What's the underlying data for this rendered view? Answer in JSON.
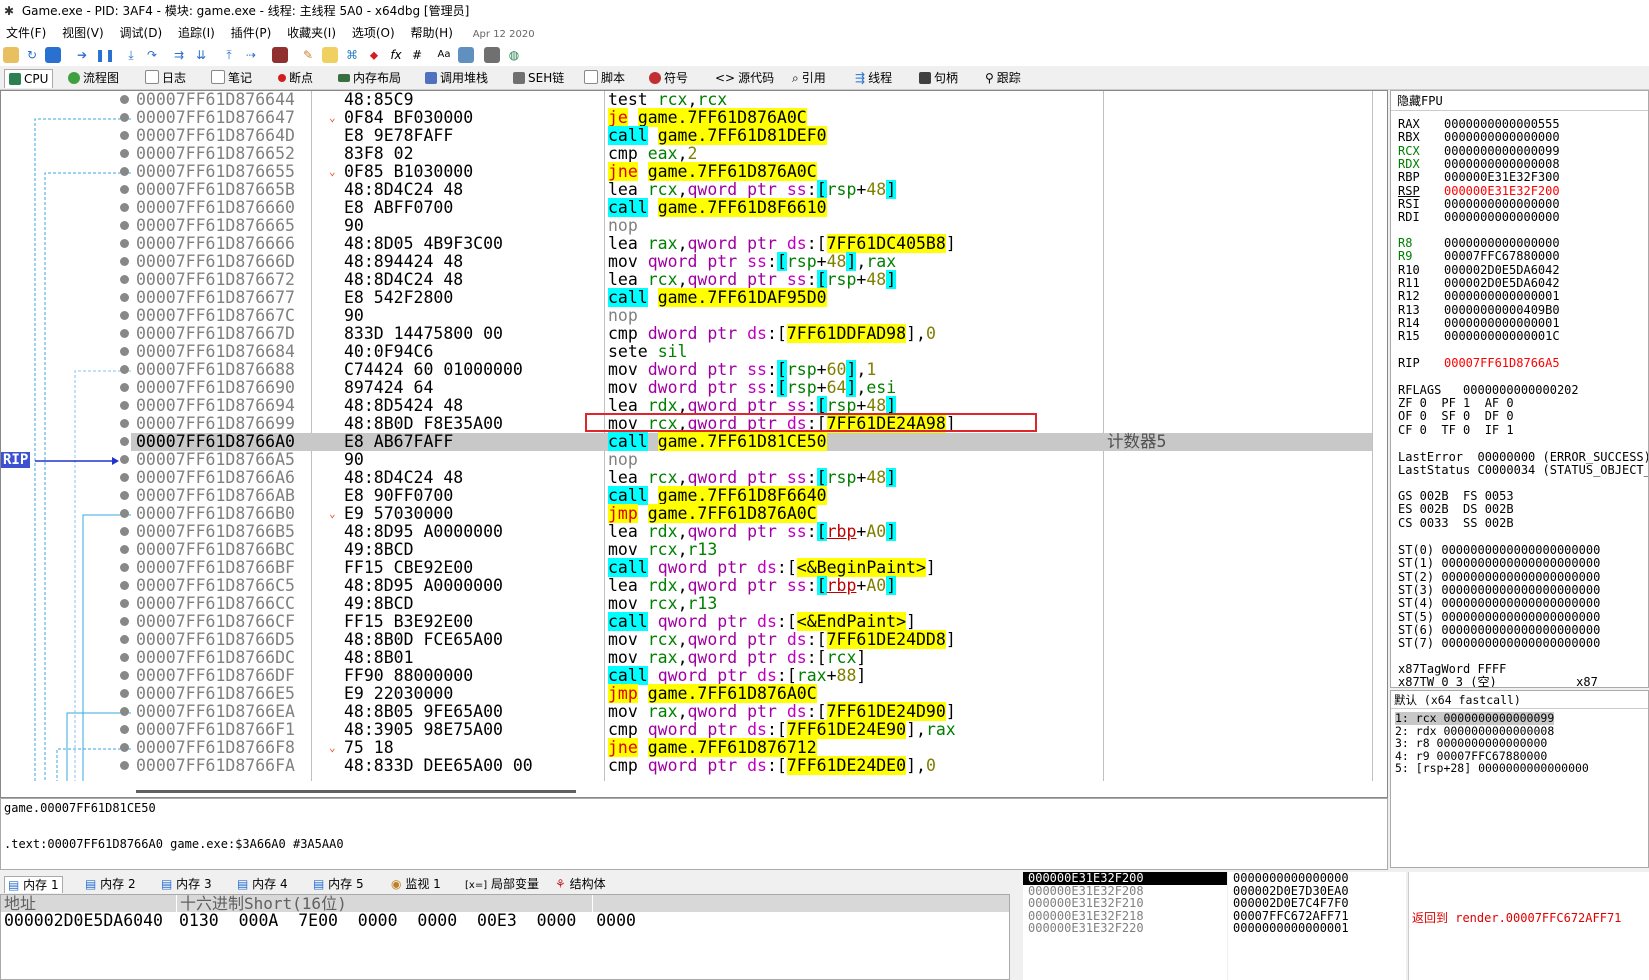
{
  "window": {
    "title": "Game.exe - PID: 3AF4 - 模块: game.exe - 线程: 主线程 5A0 - x64dbg [管理员]"
  },
  "menu": {
    "items": [
      "文件(F)",
      "视图(V)",
      "调试(D)",
      "追踪(I)",
      "插件(P)",
      "收藏夹(I)",
      "选项(O)",
      "帮助(H)"
    ],
    "date": "Apr 12 2020"
  },
  "toolbar": {
    "icons": [
      "open-icon",
      "restart-icon",
      "stop-icon",
      "run-icon",
      "pause-icon",
      "step-into-icon",
      "step-over-icon",
      "trace-into-icon",
      "trace-over-icon",
      "execute-till-return-icon",
      "run-to-user-code-icon",
      "scylla-icon",
      "patch-icon",
      "comment-icon",
      "label-icon",
      "bookmark-icon",
      "function-icon",
      "hash-icon",
      "font-icon",
      "strings-icon",
      "calculator-icon",
      "globe-icon"
    ]
  },
  "tabs": [
    {
      "label": "CPU",
      "icon": "cpu-icon",
      "active": true
    },
    {
      "label": "流程图",
      "icon": "graph-icon"
    },
    {
      "label": "日志",
      "icon": "log-icon"
    },
    {
      "label": "笔记",
      "icon": "notes-icon"
    },
    {
      "label": "断点",
      "icon": "breakpoint-icon"
    },
    {
      "label": "内存布局",
      "icon": "memory-map-icon"
    },
    {
      "label": "调用堆栈",
      "icon": "callstack-icon"
    },
    {
      "label": "SEH链",
      "icon": "seh-icon"
    },
    {
      "label": "脚本",
      "icon": "script-icon"
    },
    {
      "label": "符号",
      "icon": "symbol-icon"
    },
    {
      "label": "源代码",
      "icon": "source-icon"
    },
    {
      "label": "引用",
      "icon": "references-icon"
    },
    {
      "label": "线程",
      "icon": "threads-icon"
    },
    {
      "label": "句柄",
      "icon": "handles-icon"
    },
    {
      "label": "跟踪",
      "icon": "trace-icon"
    }
  ],
  "disasm": {
    "rip_label": "RIP",
    "rows": [
      {
        "addr": "00007FF61D876644",
        "bytes": "48:85C9",
        "mark": "",
        "html": "<span class='mn'>test</span> <span class='rg'>rcx</span>,<span class='rg'>rcx</span>",
        "comment": ""
      },
      {
        "addr": "00007FF61D876647",
        "bytes": "0F84 BF030000",
        "mark": "⌄",
        "html": "<span class='mn-je'>je</span> <span class='hl-y'>game.7FF61D876A0C</span>",
        "comment": ""
      },
      {
        "addr": "00007FF61D87664D",
        "bytes": "E8 9E78FAFF",
        "mark": "",
        "html": "<span class='mn-call'>call</span> <span class='hl-y'>game.7FF61D81DEF0</span>",
        "comment": ""
      },
      {
        "addr": "00007FF61D876652",
        "bytes": "83F8 02",
        "mark": "",
        "html": "<span class='mn'>cmp</span> <span class='rg'>eax</span>,<span class='num'>2</span>",
        "comment": ""
      },
      {
        "addr": "00007FF61D876655",
        "bytes": "0F85 B1030000",
        "mark": "⌄",
        "html": "<span class='mn-je'>jne</span> <span class='hl-y'>game.7FF61D876A0C</span>",
        "comment": ""
      },
      {
        "addr": "00007FF61D87665B",
        "bytes": "48:8D4C24 48",
        "mark": "",
        "html": "<span class='mn'>lea</span> <span class='rg'>rcx</span>,<span class='kw'>qword ptr</span> <span class='sg'>ss</span>:<span class='hl-c'>[</span><span class='rg'>rsp</span>+<span class='num'>48</span><span class='hl-c'>]</span>",
        "comment": ""
      },
      {
        "addr": "00007FF61D876660",
        "bytes": "E8 ABFF0700",
        "mark": "",
        "html": "<span class='mn-call'>call</span> <span class='hl-y'>game.7FF61D8F6610</span>",
        "comment": ""
      },
      {
        "addr": "00007FF61D876665",
        "bytes": "90",
        "mark": "",
        "html": "<span class='mn-nop'>nop</span>",
        "comment": ""
      },
      {
        "addr": "00007FF61D876666",
        "bytes": "48:8D05 4B9F3C00",
        "mark": "",
        "html": "<span class='mn'>lea</span> <span class='rg'>rax</span>,<span class='kw'>qword ptr</span> <span class='sg'>ds</span>:[<span class='hl-y'>7FF61DC405B8</span>]",
        "comment": ""
      },
      {
        "addr": "00007FF61D87666D",
        "bytes": "48:894424 48",
        "mark": "",
        "html": "<span class='mn'>mov</span> <span class='kw'>qword ptr</span> <span class='sg'>ss</span>:<span class='hl-c'>[</span><span class='rg'>rsp</span>+<span class='num'>48</span><span class='hl-c'>]</span>,<span class='rg'>rax</span>",
        "comment": ""
      },
      {
        "addr": "00007FF61D876672",
        "bytes": "48:8D4C24 48",
        "mark": "",
        "html": "<span class='mn'>lea</span> <span class='rg'>rcx</span>,<span class='kw'>qword ptr</span> <span class='sg'>ss</span>:<span class='hl-c'>[</span><span class='rg'>rsp</span>+<span class='num'>48</span><span class='hl-c'>]</span>",
        "comment": ""
      },
      {
        "addr": "00007FF61D876677",
        "bytes": "E8 542F2800",
        "mark": "",
        "html": "<span class='mn-call'>call</span> <span class='hl-y'>game.7FF61DAF95D0</span>",
        "comment": ""
      },
      {
        "addr": "00007FF61D87667C",
        "bytes": "90",
        "mark": "",
        "html": "<span class='mn-nop'>nop</span>",
        "comment": ""
      },
      {
        "addr": "00007FF61D87667D",
        "bytes": "833D 14475800 00",
        "mark": "",
        "html": "<span class='mn'>cmp</span> <span class='kw'>dword ptr</span> <span class='sg'>ds</span>:[<span class='hl-y'>7FF61DDFAD98</span>],<span class='num'>0</span>",
        "comment": ""
      },
      {
        "addr": "00007FF61D876684",
        "bytes": "40:0F94C6",
        "mark": "",
        "html": "<span class='mn'>sete</span> <span class='rg'>sil</span>",
        "comment": ""
      },
      {
        "addr": "00007FF61D876688",
        "bytes": "C74424 60 01000000",
        "mark": "",
        "html": "<span class='mn'>mov</span> <span class='kw'>dword ptr</span> <span class='sg'>ss</span>:<span class='hl-c'>[</span><span class='rg'>rsp</span>+<span class='num'>60</span><span class='hl-c'>]</span>,<span class='num'>1</span>",
        "comment": ""
      },
      {
        "addr": "00007FF61D876690",
        "bytes": "897424 64",
        "mark": "",
        "html": "<span class='mn'>mov</span> <span class='kw'>dword ptr</span> <span class='sg'>ss</span>:<span class='hl-c'>[</span><span class='rg'>rsp</span>+<span class='num'>64</span><span class='hl-c'>]</span>,<span class='rg'>esi</span>",
        "comment": ""
      },
      {
        "addr": "00007FF61D876694",
        "bytes": "48:8D5424 48",
        "mark": "",
        "html": "<span class='mn'>lea</span> <span class='rg'>rdx</span>,<span class='kw'>qword ptr</span> <span class='sg'>ss</span>:<span class='hl-c'>[</span><span class='rg'>rsp</span>+<span class='num'>48</span><span class='hl-c'>]</span>",
        "comment": ""
      },
      {
        "addr": "00007FF61D876699",
        "bytes": "48:8B0D F8E35A00",
        "mark": "",
        "html": "<span class='mn'>mov</span> <span class='rg'>rcx</span>,<span class='kw'>qword ptr</span> <span class='sg'>ds</span>:[<span class='hl-y'>7FF61DE24A98</span>]",
        "comment": ""
      },
      {
        "addr": "00007FF61D8766A0",
        "bytes": "E8 AB67FAFF",
        "mark": "",
        "html": "<span class='mn-call'>call</span> <span class='hl-y'>game.7FF61D81CE50</span>",
        "comment": "计数器5",
        "current": true
      },
      {
        "addr": "00007FF61D8766A5",
        "bytes": "90",
        "mark": "",
        "html": "<span class='mn-nop'>nop</span>",
        "comment": ""
      },
      {
        "addr": "00007FF61D8766A6",
        "bytes": "48:8D4C24 48",
        "mark": "",
        "html": "<span class='mn'>lea</span> <span class='rg'>rcx</span>,<span class='kw'>qword ptr</span> <span class='sg'>ss</span>:<span class='hl-c'>[</span><span class='rg'>rsp</span>+<span class='num'>48</span><span class='hl-c'>]</span>",
        "comment": ""
      },
      {
        "addr": "00007FF61D8766AB",
        "bytes": "E8 90FF0700",
        "mark": "",
        "html": "<span class='mn-call'>call</span> <span class='hl-y'>game.7FF61D8F6640</span>",
        "comment": ""
      },
      {
        "addr": "00007FF61D8766B0",
        "bytes": "E9 57030000",
        "mark": "⌄",
        "html": "<span class='mn-je'>jmp</span> <span class='hl-y'>game.7FF61D876A0C</span>",
        "comment": ""
      },
      {
        "addr": "00007FF61D8766B5",
        "bytes": "48:8D95 A0000000",
        "mark": "",
        "html": "<span class='mn'>lea</span> <span class='rg'>rdx</span>,<span class='kw'>qword ptr</span> <span class='sg'>ss</span>:<span class='hl-c'>[</span><span class='rbp'>rbp</span>+<span class='num'>A0</span><span class='hl-c'>]</span>",
        "comment": ""
      },
      {
        "addr": "00007FF61D8766BC",
        "bytes": "49:8BCD",
        "mark": "",
        "html": "<span class='mn'>mov</span> <span class='rg'>rcx</span>,<span class='rg'>r13</span>",
        "comment": ""
      },
      {
        "addr": "00007FF61D8766BF",
        "bytes": "FF15 CBE92E00",
        "mark": "",
        "html": "<span class='mn-call'>call</span> <span class='kw'>qword ptr</span> <span class='sg'>ds</span>:[<span class='hl-y'>&lt;&amp;BeginPaint&gt;</span>]",
        "comment": ""
      },
      {
        "addr": "00007FF61D8766C5",
        "bytes": "48:8D95 A0000000",
        "mark": "",
        "html": "<span class='mn'>lea</span> <span class='rg'>rdx</span>,<span class='kw'>qword ptr</span> <span class='sg'>ss</span>:<span class='hl-c'>[</span><span class='rbp'>rbp</span>+<span class='num'>A0</span><span class='hl-c'>]</span>",
        "comment": ""
      },
      {
        "addr": "00007FF61D8766CC",
        "bytes": "49:8BCD",
        "mark": "",
        "html": "<span class='mn'>mov</span> <span class='rg'>rcx</span>,<span class='rg'>r13</span>",
        "comment": ""
      },
      {
        "addr": "00007FF61D8766CF",
        "bytes": "FF15 B3E92E00",
        "mark": "",
        "html": "<span class='mn-call'>call</span> <span class='kw'>qword ptr</span> <span class='sg'>ds</span>:[<span class='hl-y'>&lt;&amp;EndPaint&gt;</span>]",
        "comment": ""
      },
      {
        "addr": "00007FF61D8766D5",
        "bytes": "48:8B0D FCE65A00",
        "mark": "",
        "html": "<span class='mn'>mov</span> <span class='rg'>rcx</span>,<span class='kw'>qword ptr</span> <span class='sg'>ds</span>:[<span class='hl-y'>7FF61DE24DD8</span>]",
        "comment": ""
      },
      {
        "addr": "00007FF61D8766DC",
        "bytes": "48:8B01",
        "mark": "",
        "html": "<span class='mn'>mov</span> <span class='rg'>rax</span>,<span class='kw'>qword ptr</span> <span class='sg'>ds</span>:[<span class='rg'>rcx</span>]",
        "comment": ""
      },
      {
        "addr": "00007FF61D8766DF",
        "bytes": "FF90 88000000",
        "mark": "",
        "html": "<span class='mn-call'>call</span> <span class='kw'>qword ptr</span> <span class='sg'>ds</span>:[<span class='rg'>rax</span>+<span class='num'>88</span>]",
        "comment": ""
      },
      {
        "addr": "00007FF61D8766E5",
        "bytes": "E9 22030000",
        "mark": "",
        "html": "<span class='mn-je'>jmp</span> <span class='hl-y'>game.7FF61D876A0C</span>",
        "comment": ""
      },
      {
        "addr": "00007FF61D8766EA",
        "bytes": "48:8B05 9FE65A00",
        "mark": "",
        "html": "<span class='mn'>mov</span> <span class='rg'>rax</span>,<span class='kw'>qword ptr</span> <span class='sg'>ds</span>:[<span class='hl-y'>7FF61DE24D90</span>]",
        "comment": ""
      },
      {
        "addr": "00007FF61D8766F1",
        "bytes": "48:3905 98E75A00",
        "mark": "",
        "html": "<span class='mn'>cmp</span> <span class='kw'>qword ptr</span> <span class='sg'>ds</span>:[<span class='hl-y'>7FF61DE24E90</span>],<span class='rg'>rax</span>",
        "comment": ""
      },
      {
        "addr": "00007FF61D8766F8",
        "bytes": "75 18",
        "mark": "⌄",
        "html": "<span class='mn-je'>jne</span> <span class='hl-y'>game.7FF61D876712</span>",
        "comment": ""
      },
      {
        "addr": "00007FF61D8766FA",
        "bytes": "48:833D DEE65A00 00",
        "mark": "",
        "html": "<span class='mn'>cmp</span> <span class='kw'>qword ptr</span> <span class='sg'>ds</span>:[<span class='hl-y'>7FF61DE24DE0</span>],<span class='num'>0</span>",
        "comment": ""
      }
    ]
  },
  "info": {
    "line1": "game.00007FF61D81CE50",
    "line2": ".text:00007FF61D8766A0 game.exe:$3A66A0 #3A5AA0"
  },
  "registers": {
    "header": "隐藏FPU",
    "gp": [
      {
        "name": "RAX",
        "value": "0000000000000555"
      },
      {
        "name": "RBX",
        "value": "0000000000000000"
      },
      {
        "name": "RCX",
        "value": "0000000000000099",
        "green": true
      },
      {
        "name": "RDX",
        "value": "0000000000000008",
        "green": true
      },
      {
        "name": "RBP",
        "value": "000000E31E32F300"
      },
      {
        "name": "RSP",
        "value": "000000E31E32F200",
        "changed": true
      },
      {
        "name": "RSI",
        "value": "0000000000000000"
      },
      {
        "name": "RDI",
        "value": "0000000000000000"
      }
    ],
    "ext": [
      {
        "name": "R8",
        "value": "0000000000000000",
        "green": true
      },
      {
        "name": "R9",
        "value": "00007FFC67880000",
        "green": true
      },
      {
        "name": "R10",
        "value": "000002D0E5DA6042"
      },
      {
        "name": "R11",
        "value": "000002D0E5DA6042"
      },
      {
        "name": "R12",
        "value": "0000000000000001"
      },
      {
        "name": "R13",
        "value": "00000000000409B0"
      },
      {
        "name": "R14",
        "value": "0000000000000001"
      },
      {
        "name": "R15",
        "value": "000000000000001C"
      }
    ],
    "rip": {
      "name": "RIP",
      "value": "00007FF61D8766A5"
    },
    "rflags": "RFLAGS   0000000000000202",
    "flags": [
      "ZF 0  PF 1  AF 0",
      "OF 0  SF 0  DF 0",
      "CF 0  TF 0  IF 1"
    ],
    "last": [
      "LastError  00000000 (ERROR_SUCCESS)",
      "LastStatus C0000034 (STATUS_OBJECT_NAME_NOT_FOUND)"
    ],
    "seg": [
      "GS 002B  FS 0053",
      "ES 002B  DS 002B",
      "CS 0033  SS 002B"
    ],
    "st": [
      "ST(0) 0000000000000000000000",
      "ST(1) 0000000000000000000000",
      "ST(2) 0000000000000000000000",
      "ST(3) 0000000000000000000000",
      "ST(4) 0000000000000000000000",
      "ST(5) 0000000000000000000000",
      "ST(6) 0000000000000000000000",
      "ST(7) 0000000000000000000000"
    ],
    "tag": "x87TagWord FFFF",
    "tag2": "x87TW_0 3 (空)           x87"
  },
  "callconv": {
    "header": "默认 (x64 fastcall)",
    "args": [
      "1: rcx 0000000000000099",
      "2: rdx 0000000000000008",
      "3: r8 0000000000000000",
      "4: r9 00007FFC67880000",
      "5: [rsp+28] 0000000000000000"
    ]
  },
  "bottom_tabs": [
    {
      "label": "内存 1",
      "icon": "memory-icon",
      "active": true
    },
    {
      "label": "内存 2",
      "icon": "memory-icon"
    },
    {
      "label": "内存 3",
      "icon": "memory-icon"
    },
    {
      "label": "内存 4",
      "icon": "memory-icon"
    },
    {
      "label": "内存 5",
      "icon": "memory-icon"
    },
    {
      "label": "监视 1",
      "icon": "watch-icon"
    },
    {
      "label": "局部变量",
      "icon": "locals-icon"
    },
    {
      "label": "结构体",
      "icon": "struct-icon"
    }
  ],
  "dump": {
    "addr_header": "地址",
    "hex_header": "十六进制Short(16位)",
    "row_addr": "000002D0E5DA6040",
    "row_hex": "0130  000A  7E00  0000  0000  00E3  0000  0000"
  },
  "stack": {
    "addrs": [
      "000000E31E32F200",
      "000000E31E32F208",
      "000000E31E32F210",
      "000000E31E32F218",
      "000000E31E32F220"
    ],
    "values": [
      "0000000000000000",
      "000002D0E7D30EA0",
      "000002D0E7C4F7F0",
      "00007FFC672AFF71",
      "0000000000000001"
    ],
    "comment": "返回到 render.00007FFC672AFF71"
  }
}
